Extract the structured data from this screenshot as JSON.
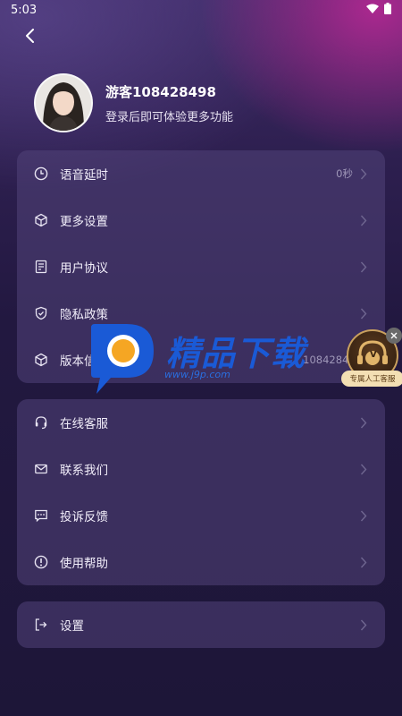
{
  "status_bar": {
    "time": "5:03"
  },
  "profile": {
    "username": "游客108428498",
    "login_hint": "登录后即可体验更多功能"
  },
  "card1": {
    "items": [
      {
        "label": "语音延时",
        "value": "0秒",
        "icon": "clock-icon"
      },
      {
        "label": "更多设置",
        "icon": "cube-icon"
      },
      {
        "label": "用户协议",
        "icon": "document-icon"
      },
      {
        "label": "隐私政策",
        "icon": "shield-icon"
      },
      {
        "label": "版本信息",
        "value": "108428498",
        "icon": "cube-icon"
      }
    ]
  },
  "card2": {
    "items": [
      {
        "label": "在线客服",
        "icon": "headset-icon"
      },
      {
        "label": "联系我们",
        "icon": "mail-icon"
      },
      {
        "label": "投诉反馈",
        "icon": "message-icon"
      },
      {
        "label": "使用帮助",
        "icon": "info-icon"
      }
    ]
  },
  "card3": {
    "items": [
      {
        "label": "设置",
        "icon": "logout-icon"
      }
    ]
  },
  "watermark": {
    "title": "精品下载",
    "url": "www.j9p.com"
  },
  "customer_service_widget": {
    "label": "专属人工客服",
    "badge": "V"
  },
  "colors": {
    "card_bg": "#52447a",
    "muted_text": "#9f97b8",
    "accent_orange": "#f5a623",
    "watermark_blue": "#1a5ad6"
  }
}
